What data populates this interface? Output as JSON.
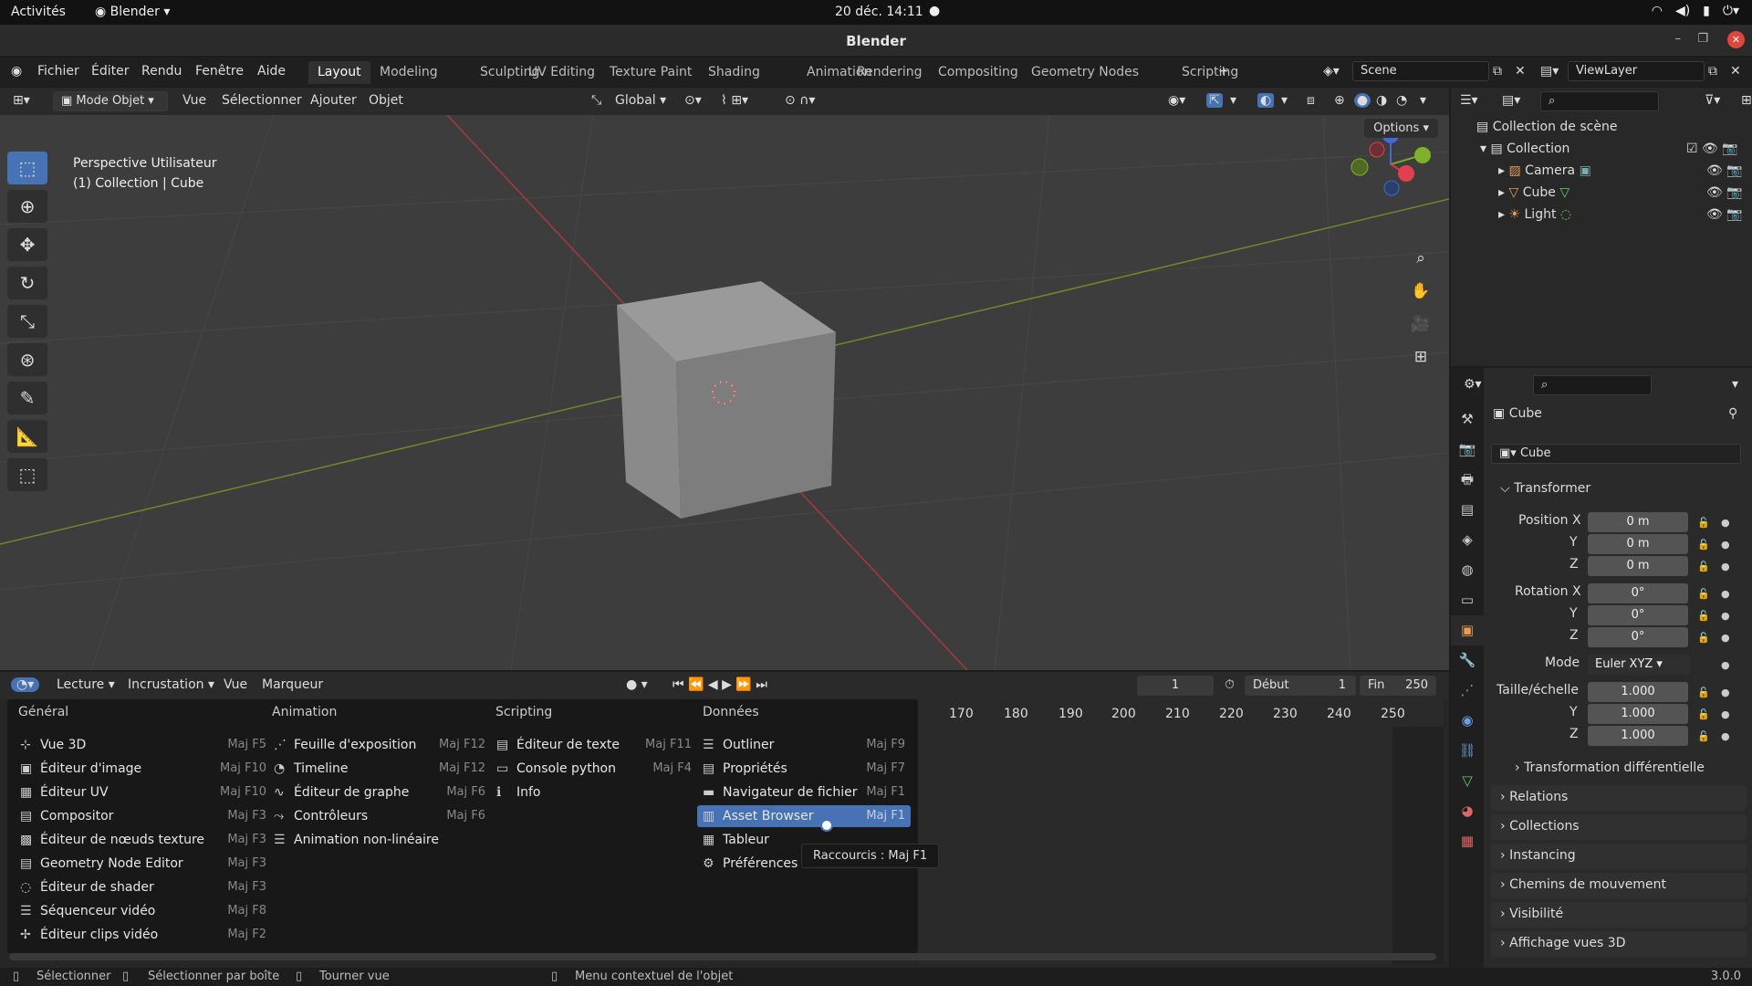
{
  "system": {
    "activities": "Activités",
    "app": "Blender",
    "clock": "20 déc. 14:11"
  },
  "window": {
    "title": "Blender"
  },
  "menu": {
    "fichier": "Fichier",
    "editer": "Éditer",
    "rendu": "Rendu",
    "fenetre": "Fenêtre",
    "aide": "Aide"
  },
  "workspaces": [
    "Layout",
    "Modeling",
    "Sculpting",
    "UV Editing",
    "Texture Paint",
    "Shading",
    "Animation",
    "Rendering",
    "Compositing",
    "Geometry Nodes",
    "Scripting"
  ],
  "scene": "Scene",
  "viewlayer": "ViewLayer",
  "viewport": {
    "mode": "Mode Objet",
    "vue": "Vue",
    "selectionner": "Sélectionner",
    "ajouter": "Ajouter",
    "objet": "Objet",
    "orientation": "Global",
    "options": "Options",
    "info1": "Perspective Utilisateur",
    "info2": "(1) Collection | Cube"
  },
  "outliner": {
    "root": "Collection de scène",
    "collection": "Collection",
    "items": [
      "Camera",
      "Cube",
      "Light"
    ]
  },
  "properties": {
    "object": "Cube",
    "datablock": "Cube",
    "transform": "Transformer",
    "pos_label": "Position X",
    "rot_label": "Rotation X",
    "y": "Y",
    "z": "Z",
    "pos": [
      "0 m",
      "0 m",
      "0 m"
    ],
    "rot": [
      "0°",
      "0°",
      "0°"
    ],
    "mode_label": "Mode",
    "mode": "Euler XYZ",
    "scale_label": "Taille/échelle",
    "scale": [
      "1.000",
      "1.000",
      "1.000"
    ],
    "delta": "Transformation différentielle",
    "sections": [
      "Relations",
      "Collections",
      "Instancing",
      "Chemins de mouvement",
      "Visibilité",
      "Affichage vues 3D"
    ]
  },
  "timeline": {
    "lecture": "Lecture",
    "incrustation": "Incrustation",
    "vue": "Vue",
    "marqueur": "Marqueur",
    "frame": "1",
    "debut_label": "Début",
    "debut": "1",
    "fin_label": "Fin",
    "fin": "250",
    "ticks": [
      "170",
      "180",
      "190",
      "200",
      "210",
      "220",
      "230",
      "240",
      "250"
    ]
  },
  "editor_menu": {
    "general": {
      "title": "Général",
      "items": [
        [
          "Vue 3D",
          "Maj F5"
        ],
        [
          "Éditeur d'image",
          "Maj F10"
        ],
        [
          "Éditeur UV",
          "Maj F10"
        ],
        [
          "Compositor",
          "Maj F3"
        ],
        [
          "Éditeur de nœuds texture",
          "Maj F3"
        ],
        [
          "Geometry Node Editor",
          "Maj F3"
        ],
        [
          "Éditeur de shader",
          "Maj F3"
        ],
        [
          "Séquenceur vidéo",
          "Maj F8"
        ],
        [
          "Éditeur clips vidéo",
          "Maj F2"
        ]
      ]
    },
    "animation": {
      "title": "Animation",
      "items": [
        [
          "Feuille d'exposition",
          "Maj F12"
        ],
        [
          "Timeline",
          "Maj F12"
        ],
        [
          "Éditeur de graphe",
          "Maj F6"
        ],
        [
          "Contrôleurs",
          "Maj F6"
        ],
        [
          "Animation non-linéaire",
          ""
        ]
      ]
    },
    "scripting": {
      "title": "Scripting",
      "items": [
        [
          "Éditeur de texte",
          "Maj F11"
        ],
        [
          "Console python",
          "Maj F4"
        ],
        [
          "Info",
          ""
        ]
      ]
    },
    "donnees": {
      "title": "Données",
      "items": [
        [
          "Outliner",
          "Maj F9"
        ],
        [
          "Propriétés",
          "Maj F7"
        ],
        [
          "Navigateur de fichier",
          "Maj F1"
        ],
        [
          "Asset Browser",
          "Maj F1"
        ],
        [
          "Tableur",
          ""
        ],
        [
          "Préférences",
          ""
        ]
      ]
    }
  },
  "tooltip": "Raccourcis : Maj F1",
  "status": {
    "s1": "Sélectionner",
    "s2": "Sélectionner par boîte",
    "s3": "Tourner vue",
    "s4": "Menu contextuel de l'objet",
    "version": "3.0.0"
  }
}
